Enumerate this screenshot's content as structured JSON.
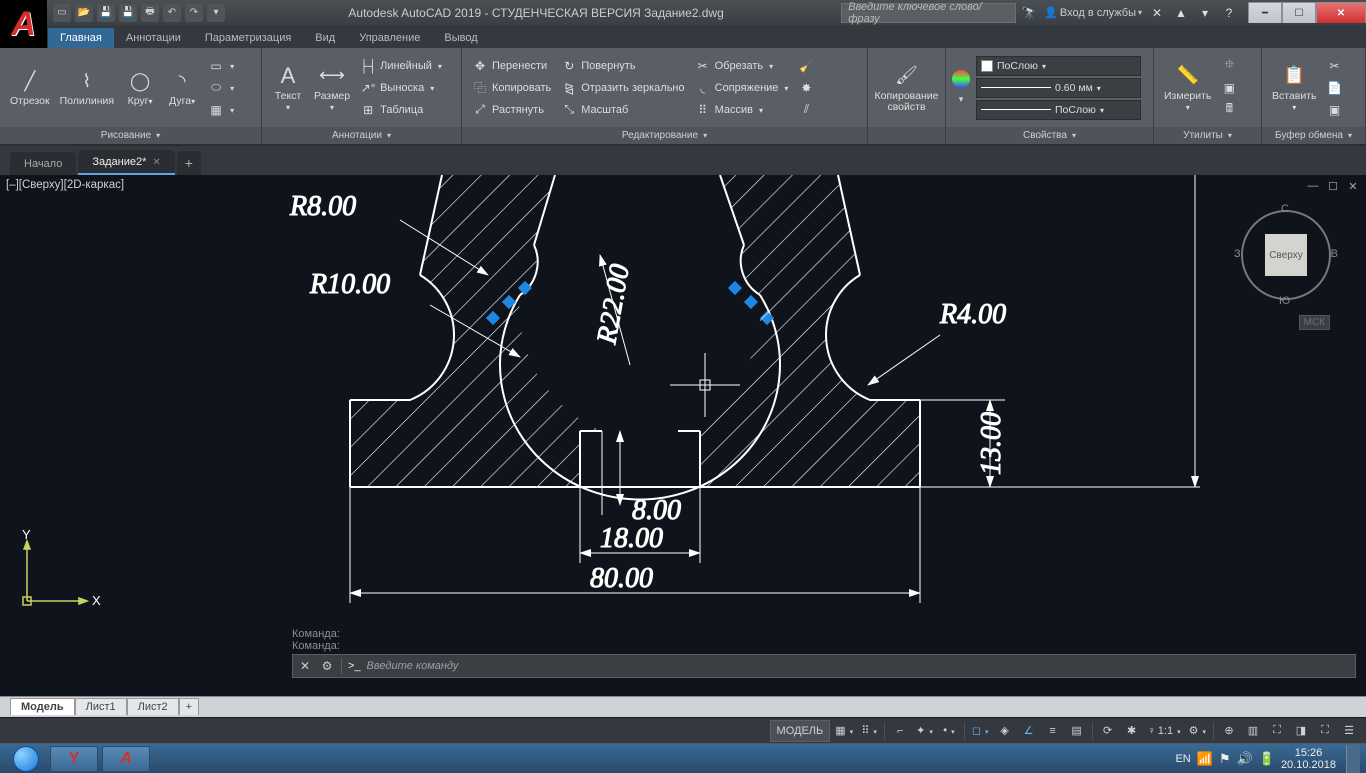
{
  "title": "Autodesk AutoCAD 2019 - СТУДЕНЧЕСКАЯ ВЕРСИЯ    Задание2.dwg",
  "search_placeholder": "Введите ключевое слово/фразу",
  "signin_label": "Вход в службы",
  "ribbon_tabs": [
    "Главная",
    "Аннотации",
    "Параметризация",
    "Вид",
    "Управление",
    "Вывод"
  ],
  "ribbon_active": 0,
  "draw": {
    "panel": "Рисование",
    "line": "Отрезок",
    "polyline": "Полилиния",
    "circle": "Круг",
    "arc": "Дуга"
  },
  "anno": {
    "panel": "Аннотации",
    "text": "Текст",
    "dim": "Размер",
    "linear": "Линейный",
    "leader": "Выноска",
    "table": "Таблица"
  },
  "edit": {
    "panel": "Редактирование",
    "move": "Перенести",
    "copy": "Копировать",
    "stretch": "Растянуть",
    "rotate": "Повернуть",
    "mirror": "Отразить зеркально",
    "scale": "Масштаб",
    "trim": "Обрезать",
    "fillet": "Сопряжение",
    "array": "Массив"
  },
  "clip_props_title": "Копирование свойств",
  "props": {
    "panel": "Свойства",
    "layer": "ПоСлою",
    "lw": "0.60 мм",
    "lt": "ПоСлою"
  },
  "util": {
    "panel": "Утилиты",
    "measure": "Измерить"
  },
  "clip": {
    "panel": "Буфер обмена",
    "paste": "Вставить"
  },
  "filetabs": {
    "home": "Начало",
    "file": "Задание2*"
  },
  "viewport": "[–][Сверху][2D-каркас]",
  "viewcube": {
    "face": "Сверху",
    "n": "С",
    "s": "Ю",
    "e": "В",
    "w": "З"
  },
  "wcs": "МСК",
  "dims": {
    "r8": "R8.00",
    "r10": "R10.00",
    "r22": "R22.00",
    "r4": "R4.00",
    "d13": "13.00",
    "d8": "8.00",
    "d18": "18.00",
    "d80": "80.00"
  },
  "ucs": {
    "x": "X",
    "y": "Y"
  },
  "cmd_history": [
    "Команда:",
    "Команда:"
  ],
  "cmd_prompt": ">_",
  "cmd_placeholder": "Введите  команду",
  "bottom_tabs": {
    "model": "Модель",
    "l1": "Лист1",
    "l2": "Лист2"
  },
  "status": {
    "model": "МОДЕЛЬ",
    "scale": "1:1"
  },
  "lang": "EN",
  "clock": {
    "time": "15:26",
    "date": "20.10.2018"
  }
}
